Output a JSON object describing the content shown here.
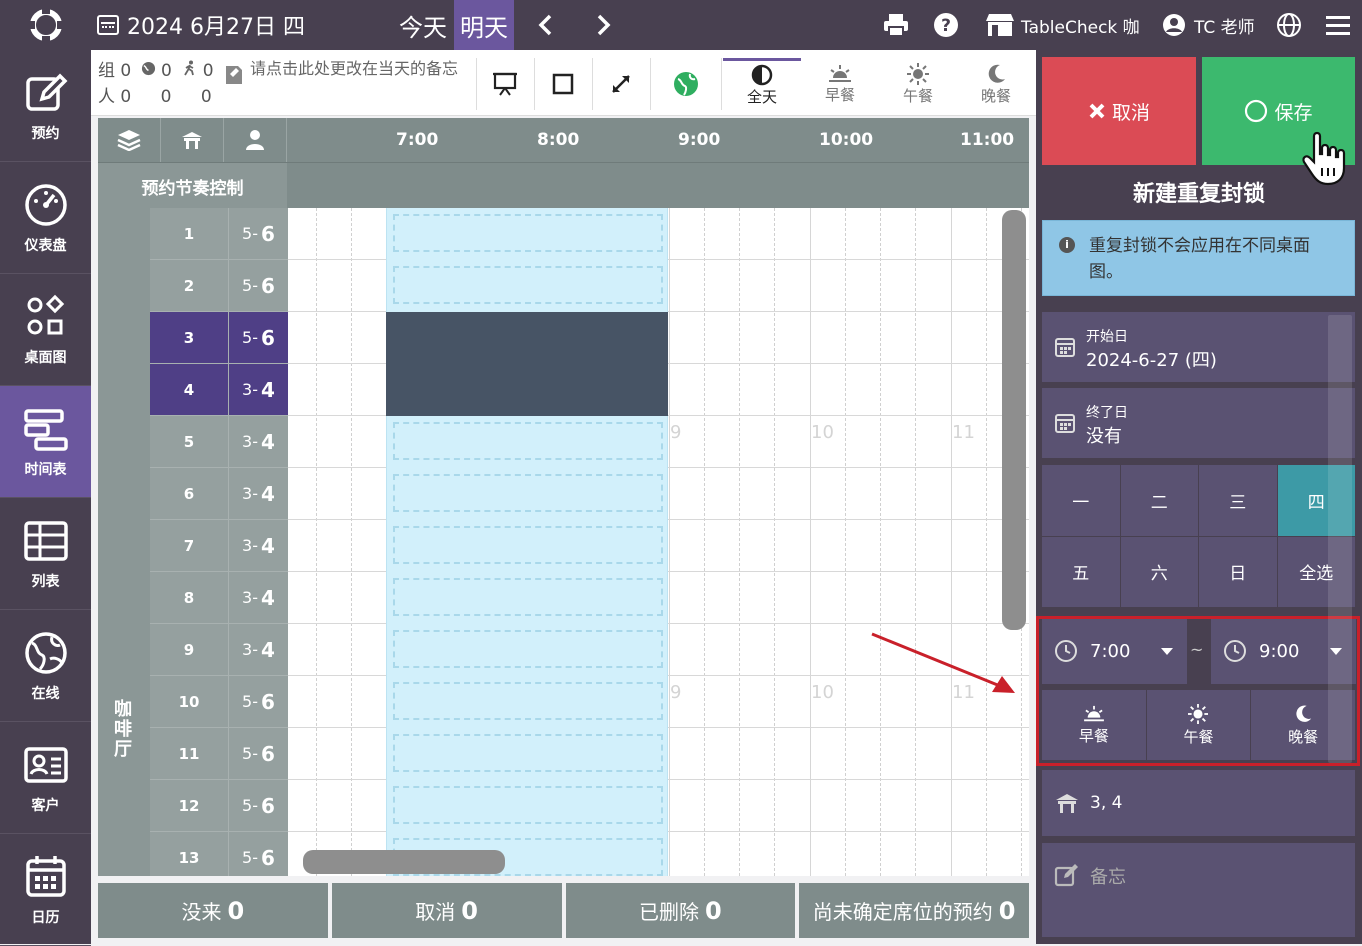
{
  "header": {
    "date": "2024 6月27日 四",
    "today": "今天",
    "tomorrow": "明天",
    "store": "TableCheck 咖",
    "user": "TC 老师"
  },
  "sidebar": {
    "items": [
      {
        "label": "预约"
      },
      {
        "label": "仪表盘"
      },
      {
        "label": "桌面图"
      },
      {
        "label": "时间表"
      },
      {
        "label": "列表"
      },
      {
        "label": "在线"
      },
      {
        "label": "客户"
      },
      {
        "label": "日历"
      }
    ]
  },
  "toolbar": {
    "group_label": "组",
    "group_count": "0",
    "web_count": "0",
    "walk_count": "0",
    "people_label": "人",
    "people_count": "0",
    "web_people": "0",
    "walk_people": "0",
    "memo_placeholder": "请点击此处更改在当天的备忘",
    "meals": [
      {
        "label": "全天"
      },
      {
        "label": "早餐"
      },
      {
        "label": "午餐"
      },
      {
        "label": "晚餐"
      }
    ]
  },
  "grid": {
    "times": [
      "7:00",
      "8:00",
      "9:00",
      "10:00",
      "11:00"
    ],
    "rhythm_label": "预约节奏控制",
    "area_name": "咖啡厅",
    "ghost": [
      "9",
      "10",
      "11"
    ],
    "rows": [
      {
        "table": "1",
        "min": "5",
        "max": "6"
      },
      {
        "table": "2",
        "min": "5",
        "max": "6"
      },
      {
        "table": "3",
        "min": "5",
        "max": "6"
      },
      {
        "table": "4",
        "min": "3",
        "max": "4"
      },
      {
        "table": "5",
        "min": "3",
        "max": "4"
      },
      {
        "table": "6",
        "min": "3",
        "max": "4"
      },
      {
        "table": "7",
        "min": "3",
        "max": "4"
      },
      {
        "table": "8",
        "min": "3",
        "max": "4"
      },
      {
        "table": "9",
        "min": "3",
        "max": "4"
      },
      {
        "table": "10",
        "min": "5",
        "max": "6"
      },
      {
        "table": "11",
        "min": "5",
        "max": "6"
      },
      {
        "table": "12",
        "min": "5",
        "max": "6"
      },
      {
        "table": "13",
        "min": "5",
        "max": "6"
      }
    ]
  },
  "bottom": [
    {
      "label": "没来",
      "count": "0"
    },
    {
      "label": "取消",
      "count": "0"
    },
    {
      "label": "已删除",
      "count": "0"
    },
    {
      "label": "尚未确定席位的预约",
      "count": "0"
    }
  ],
  "panel": {
    "cancel": "取消",
    "save": "保存",
    "title": "新建重复封锁",
    "info": "重复封锁不会应用在不同桌面图。",
    "start_label": "开始日",
    "start_value": "2024-6-27 (四)",
    "end_label": "终了日",
    "end_value": "没有",
    "days": [
      "一",
      "二",
      "三",
      "四",
      "五",
      "六",
      "日",
      "全选"
    ],
    "start_time": "7:00",
    "tilde": "~",
    "end_time": "9:00",
    "meals": [
      "早餐",
      "午餐",
      "晚餐"
    ],
    "tables": "3, 4",
    "memo": "备忘"
  }
}
